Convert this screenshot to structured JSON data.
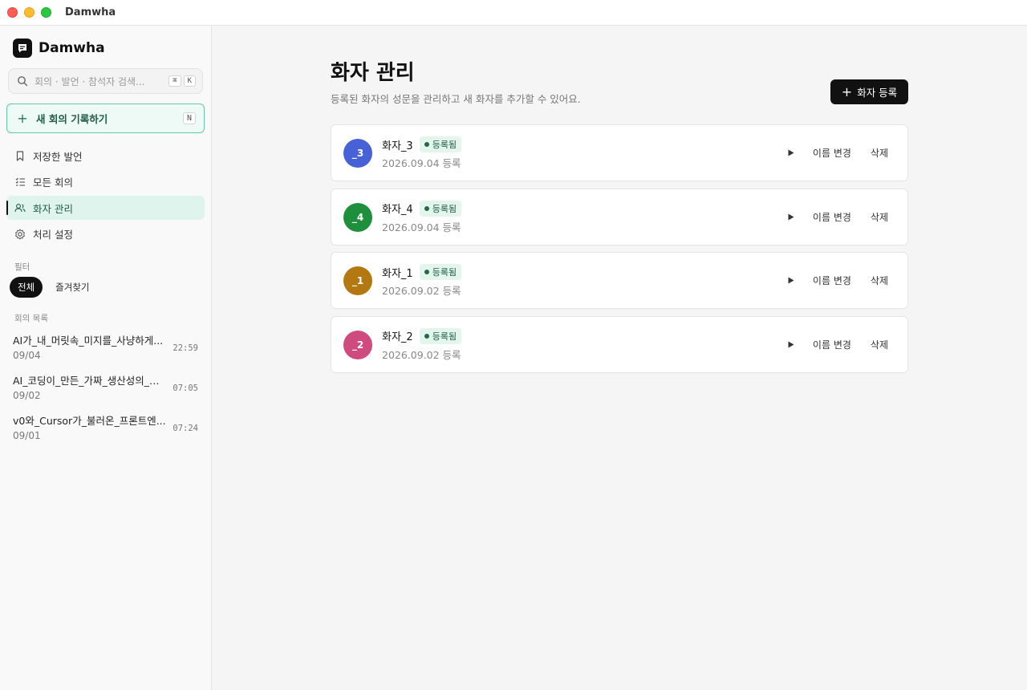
{
  "window": {
    "title": "Damwha"
  },
  "sidebar": {
    "brand": "Damwha",
    "search": {
      "placeholder": "회의 · 발언 · 참석자 검색...",
      "shortcut_mod": "⌘",
      "shortcut_key": "K"
    },
    "new_meeting": {
      "label": "새 회의 기록하기",
      "shortcut": "N"
    },
    "nav": [
      {
        "label": "저장한 발언",
        "icon": "bookmark-icon"
      },
      {
        "label": "모든 회의",
        "icon": "checklist-icon"
      },
      {
        "label": "화자 관리",
        "icon": "users-icon",
        "active": true
      },
      {
        "label": "처리 설정",
        "icon": "gear-icon"
      }
    ],
    "filter_label": "필터",
    "filters": [
      {
        "label": "전체",
        "selected": true
      },
      {
        "label": "즐겨찾기",
        "selected": false
      }
    ],
    "meetings_label": "회의 목록",
    "meetings": [
      {
        "title": "AI가_내_머릿속_미지를_사냥하게...",
        "date": "09/04",
        "time": "22:59"
      },
      {
        "title": "AI_코딩이_만든_가짜_생산성의_함정",
        "date": "09/02",
        "time": "07:05"
      },
      {
        "title": "v0와_Cursor가_불러온_프론트엔...",
        "date": "09/01",
        "time": "07:24"
      }
    ]
  },
  "main": {
    "title": "화자 관리",
    "subtitle": "등록된 화자의 성문을 관리하고 새 화자를 추가할 수 있어요.",
    "add_button": "화자 등록",
    "rename_label": "이름 변경",
    "delete_label": "삭제",
    "speakers": [
      {
        "avatar": "_3",
        "name": "화자_3",
        "status": "등록됨",
        "date": "2026.09.04 등록",
        "color": "#4762d6"
      },
      {
        "avatar": "_4",
        "name": "화자_4",
        "status": "등록됨",
        "date": "2026.09.04 등록",
        "color": "#1e8f3a"
      },
      {
        "avatar": "_1",
        "name": "화자_1",
        "status": "등록됨",
        "date": "2026.09.02 등록",
        "color": "#b3780f"
      },
      {
        "avatar": "_2",
        "name": "화자_2",
        "status": "등록됨",
        "date": "2026.09.02 등록",
        "color": "#cf4a7e"
      }
    ]
  },
  "colors": {
    "accent": "#1f7a55",
    "accent_bg": "#dff4ec",
    "primary_button": "#111111"
  }
}
